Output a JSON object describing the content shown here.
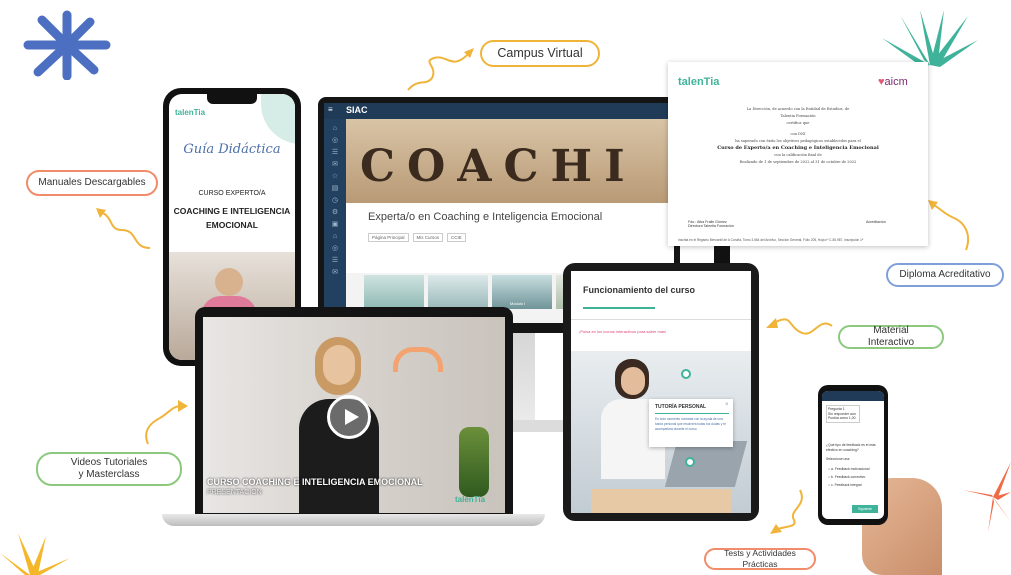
{
  "labels": {
    "campus": "Campus Virtual",
    "manuales": "Manuales Descargables",
    "diploma": "Diploma Acreditativo",
    "material": "Material Interactivo",
    "videos_line1": "Videos Tutoriales",
    "videos_line2": "y Masterclass",
    "tests": "Tests y Actividades Prácticas"
  },
  "phone_left": {
    "brand": "talenTia",
    "title": "Guía Didáctica",
    "course_label": "CURSO EXPERTO/A",
    "course_line1": "COACHING E INTELIGENCIA",
    "course_line2": "EMOCIONAL"
  },
  "monitor": {
    "logo": "SIAC",
    "banner_word": "COACHI",
    "course_title": "Experta/o en Coaching e Inteligencia Emocional",
    "tabs": [
      "Página Principal",
      "Mis Cursos",
      "CCIE"
    ],
    "thumb_caption": "Módulo I"
  },
  "certificate": {
    "brand_left": "talenTia",
    "brand_right": "aicm",
    "line1": "La Dirección, de acuerdo con la Entidad de Estudios, de",
    "line2": "Talentia Formación",
    "line3": "certifica que",
    "line4": "con DNI",
    "line5": "ha superado con éxito los objetivos pedagógicos establecidos para el",
    "course": "Curso de Experto/a en Coaching e Inteligencia Emocional",
    "line6": "con la calificación final de",
    "line7": "Realizado de 1 de septiembre de 2022 al 31 de octubre de 2022",
    "sign_left": "Fdo.: Alba Fraile Gómez",
    "sign_left_role": "Directora Talentia Formación",
    "sign_right": "Acreditación",
    "footer": "Inscrita en el Registro Mercantil de A Coruña, Tomo 3.564 del Archivo, Sección General, Folio 205, Hoja nº C-55.987, Inscripción 1ª"
  },
  "laptop": {
    "caption": "CURSO COACHING E INTELIGENCIA EMOCIONAL",
    "subcaption": "PRESENTACIÓN",
    "brand": "talenTia"
  },
  "tablet": {
    "title": "Funcionamiento del curso",
    "note": "¡Pulsa en los iconos interactivos para saber más!",
    "popup_title": "TUTORÍA PERSONAL",
    "popup_text": "En todo momento contarás con la ayuda de una tutora personal que resolverá todas tus dudas y te acompañará durante el curso."
  },
  "phone_right": {
    "q_label": "Pregunta 1",
    "q_status": "Sin responder aún",
    "q_points": "Puntúa como 1,00",
    "question": "¿Qué tipo de feedback es el más efectivo en coaching?",
    "select_label": "Seleccione una:",
    "options": [
      "a. Feedback motivacional",
      "b. Feedback correctivo",
      "c. Feedback integral"
    ],
    "button": "Siguiente"
  },
  "colors": {
    "campus_border": "#f0b43a",
    "manuales_border": "#f08c6a",
    "diploma_border": "#7f9fd8",
    "material_border": "#8cc97f",
    "videos_border": "#8cc97f",
    "tests_border": "#f08c6a",
    "brand_teal": "#3fb39a",
    "squiggle": "#f0b43a"
  }
}
